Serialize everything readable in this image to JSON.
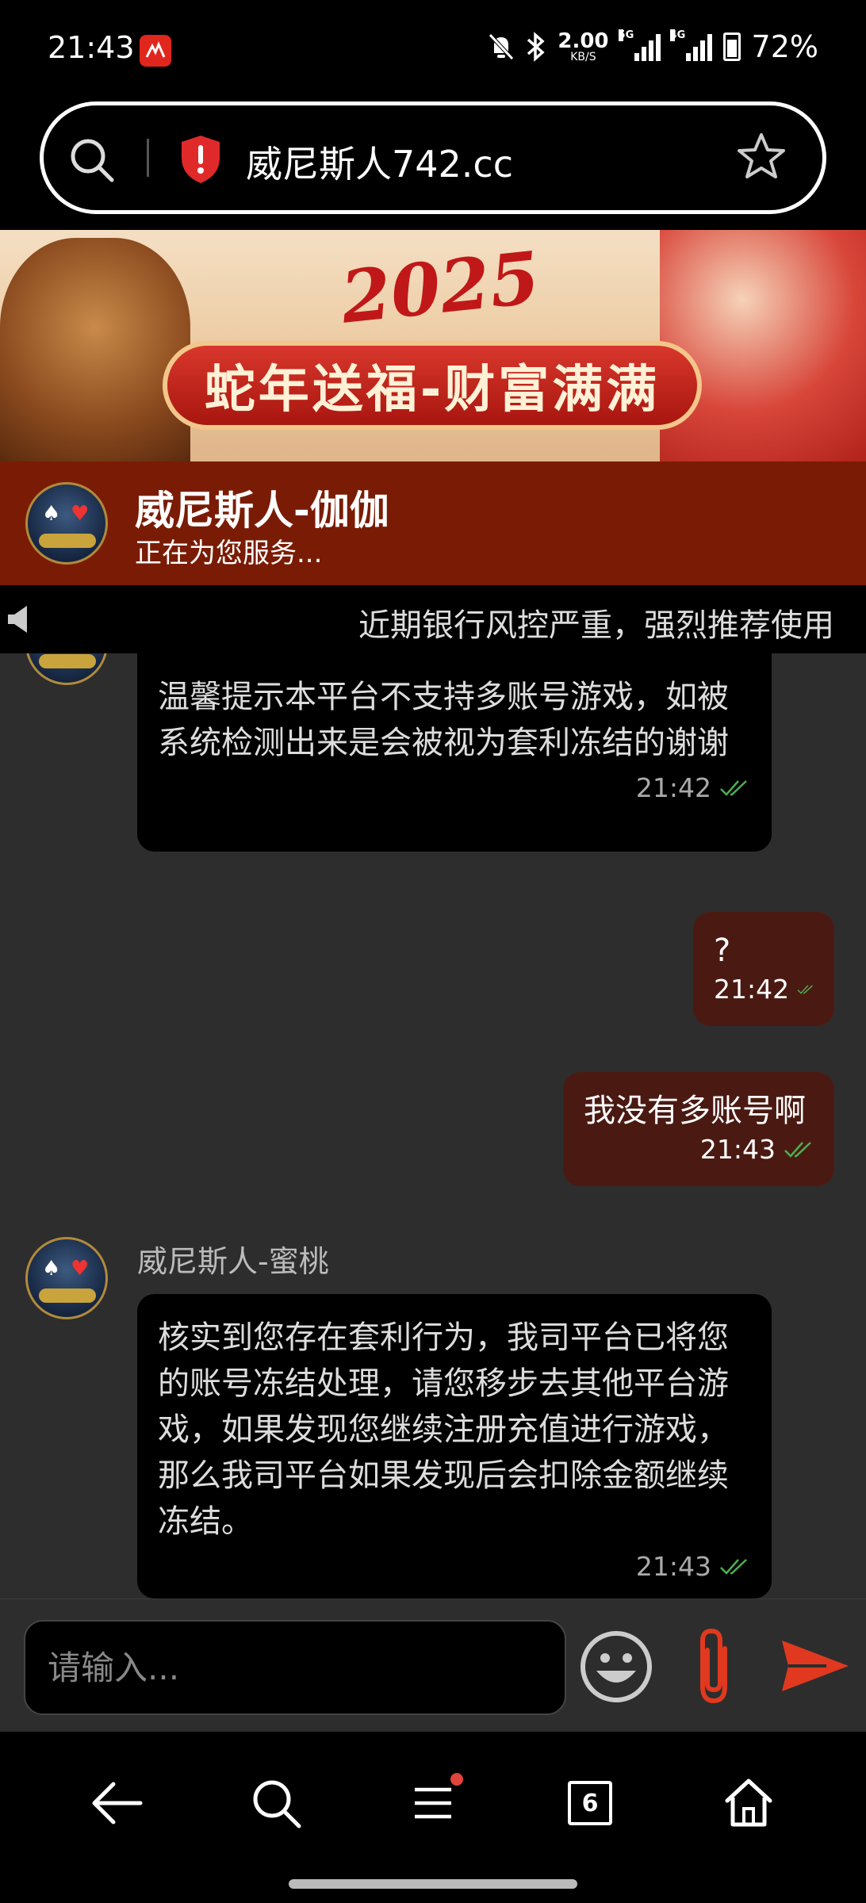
{
  "status_bar": {
    "time": "21:43",
    "net_speed_value": "2.00",
    "net_speed_unit": "KB/S",
    "signal1_label": "5G",
    "signal2_label": "4G",
    "battery": "72%"
  },
  "browser": {
    "url_text": "威尼斯人742.cc"
  },
  "banner": {
    "year": "2025",
    "slogan": "蛇年送福-财富满满"
  },
  "chat_header": {
    "agent_name": "威尼斯人-伽伽",
    "status": "正在为您服务..."
  },
  "marquee": {
    "text": "近期银行风控严重，强烈推荐使用"
  },
  "messages": [
    {
      "direction": "incoming",
      "text": "温馨提示本平台不支持多账号游戏，如被系统检测出来是会被视为套利冻结的谢谢",
      "time": "21:42"
    },
    {
      "direction": "outgoing",
      "text": "?",
      "time": "21:42"
    },
    {
      "direction": "outgoing",
      "text": "我没有多账号啊",
      "time": "21:43"
    },
    {
      "direction": "incoming",
      "sender": "威尼斯人-蜜桃",
      "text": "核实到您存在套利行为，我司平台已将您的账号冻结处理，请您移步去其他平台游戏，如果发现您继续注册充值进行游戏，那么我司平台如果发现后会扣除金额继续冻结。",
      "time": "21:43"
    }
  ],
  "input": {
    "placeholder": "请输入..."
  },
  "nav": {
    "tabs_count": "6"
  },
  "colors": {
    "header_bg": "#7a1c05",
    "chat_bg": "#2d2d2d",
    "outgoing_bubble": "#4a1a12",
    "accent_red": "#e0391f",
    "read_check": "#4caf50"
  }
}
